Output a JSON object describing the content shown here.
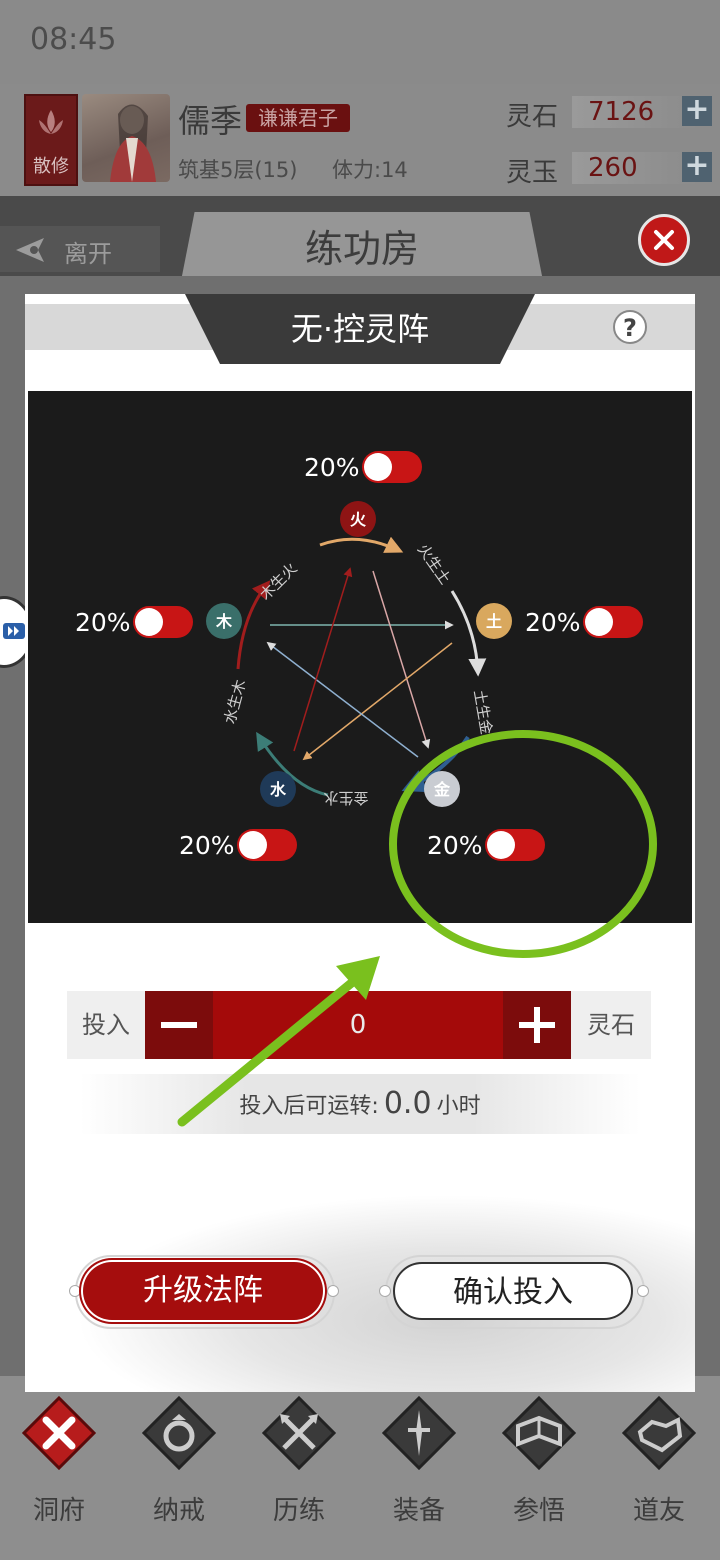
{
  "status_bar": {
    "time": "08:45"
  },
  "profile": {
    "sect_badge": "散修",
    "name": "儒季",
    "title_tag": "谦谦君子",
    "level": "筑基5层(15)",
    "stamina": "体力:14",
    "currencies": [
      {
        "label": "灵石",
        "value": "7126"
      },
      {
        "label": "灵玉",
        "value": "260"
      }
    ]
  },
  "header": {
    "leave_label": "离开",
    "room_title": "练功房"
  },
  "modal": {
    "title": "无·控灵阵",
    "help": "?",
    "elements": [
      {
        "name": "火",
        "color": "#8e1414",
        "percent": "20%",
        "on": false
      },
      {
        "name": "土",
        "color": "#d9a85e",
        "percent": "20%",
        "on": false
      },
      {
        "name": "金",
        "color": "#c9ccd2",
        "percent": "20%",
        "on": false
      },
      {
        "name": "水",
        "color": "#1f3a58",
        "percent": "20%",
        "on": false
      },
      {
        "name": "木",
        "color": "#3a6f6a",
        "percent": "20%",
        "on": false
      }
    ],
    "cycle_labels": [
      "火生土",
      "土生金",
      "金生水",
      "水生木",
      "木生火"
    ],
    "invest": {
      "label": "投入",
      "amount": "0",
      "currency": "灵石",
      "runtime_prefix": "投入后可运转:",
      "runtime_value": "0.0",
      "runtime_unit": "小时"
    },
    "upgrade_label": "升级法阵",
    "confirm_label": "确认投入"
  },
  "bottom_nav": [
    {
      "label": "洞府",
      "icon": "cross-icon",
      "active": true
    },
    {
      "label": "纳戒",
      "icon": "ring-icon",
      "active": false
    },
    {
      "label": "历练",
      "icon": "swords-icon",
      "active": false
    },
    {
      "label": "装备",
      "icon": "armor-icon",
      "active": false
    },
    {
      "label": "参悟",
      "icon": "book-icon",
      "active": false
    },
    {
      "label": "道友",
      "icon": "handshake-icon",
      "active": false
    }
  ],
  "colors": {
    "accent_red": "#a50d0d",
    "annotation_green": "#7ac01e"
  }
}
